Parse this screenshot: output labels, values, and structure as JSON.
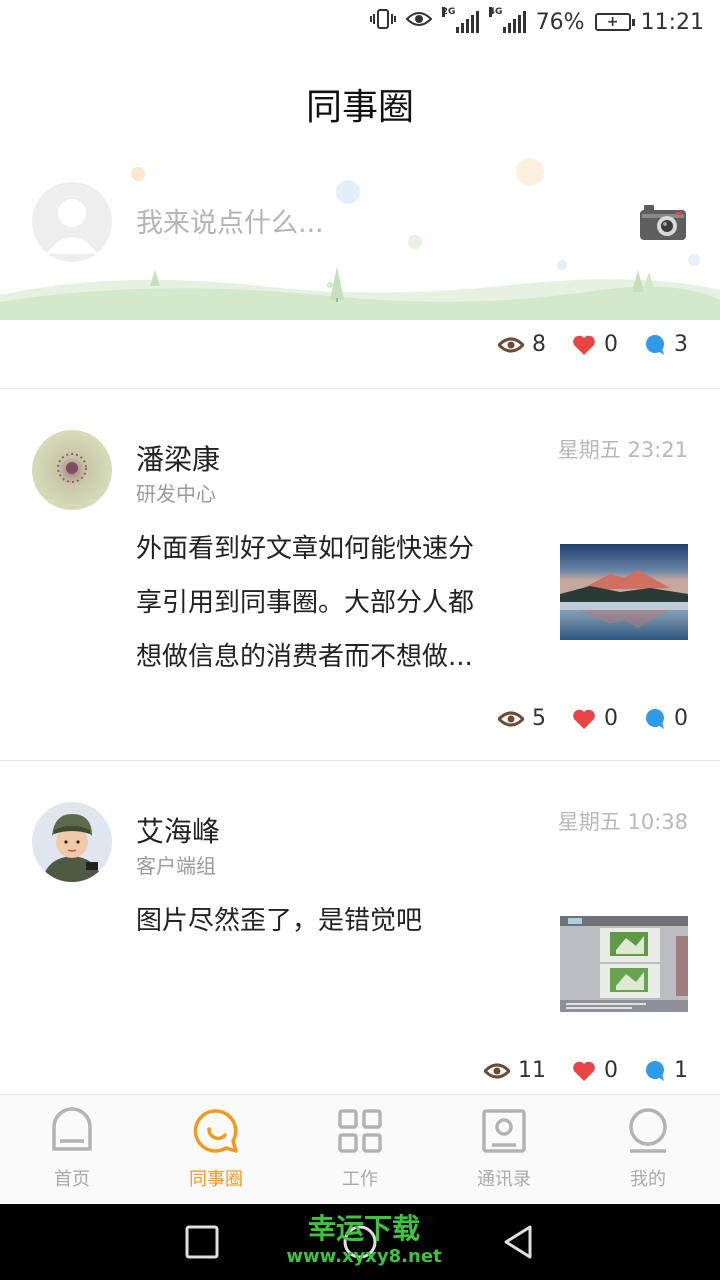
{
  "status_bar": {
    "network_1": "2G",
    "network_2": "4G",
    "battery_percent": "76%",
    "time": "11:21"
  },
  "header": {
    "title": "同事圈"
  },
  "compose": {
    "placeholder": "我来说点什么..."
  },
  "summary_stats": {
    "views": "8",
    "likes": "0",
    "comments": "3"
  },
  "posts": [
    {
      "author": "潘梁康",
      "department": "研发中心",
      "time": "星期五 23:21",
      "lines": [
        "外面看到好文章如何能快速分",
        "享引用到同事圈。大部分人都",
        "想做信息的消费者而不想做..."
      ],
      "views": "5",
      "likes": "0",
      "comments": "0"
    },
    {
      "author": "艾海峰",
      "department": "客户端组",
      "time": "星期五 10:38",
      "lines": [
        "图片尽然歪了，是错觉吧"
      ],
      "views": "11",
      "likes": "0",
      "comments": "1"
    }
  ],
  "bottom_nav": {
    "items": [
      {
        "label": "首页",
        "icon": "home-icon"
      },
      {
        "label": "同事圈",
        "icon": "chat-bubble-icon"
      },
      {
        "label": "工作",
        "icon": "grid-icon"
      },
      {
        "label": "通讯录",
        "icon": "contacts-icon"
      },
      {
        "label": "我的",
        "icon": "profile-icon"
      }
    ],
    "active_index": 1
  },
  "watermark": {
    "title": "幸运下载",
    "url": "www.xyxy8.net"
  },
  "colors": {
    "accent": "#f39a1e",
    "heart": "#e94545",
    "comment": "#2f9be8",
    "eye": "#6b4a36"
  }
}
